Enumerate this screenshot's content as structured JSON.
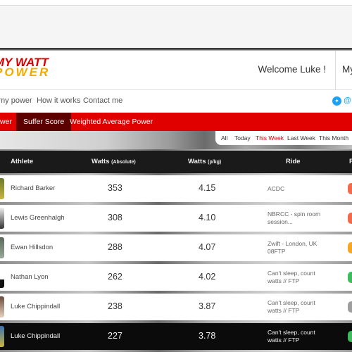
{
  "header": {
    "logo_line1": "MY WATT",
    "logo_line2": "POWER",
    "welcome": "Welcome Luke !",
    "my_menu": "My"
  },
  "nav": {
    "items": [
      {
        "label": "my power"
      },
      {
        "label": "How it works"
      },
      {
        "label": "Contact me"
      }
    ],
    "twitter_icon": "twitter-icon",
    "twitter_handle": "@"
  },
  "tabs": [
    {
      "label": "wer",
      "active": false
    },
    {
      "label": "Suffer Score",
      "active": true
    },
    {
      "label": "Weighted Average Power",
      "active": false
    }
  ],
  "filters": [
    {
      "label": "All",
      "active": false
    },
    {
      "label": "Today",
      "active": false
    },
    {
      "label": "This Week",
      "active": true
    },
    {
      "label": "Last Week",
      "active": false
    },
    {
      "label": "This Month",
      "active": false
    }
  ],
  "table": {
    "columns": {
      "athlete": "Athlete",
      "watts_abs": "Watts",
      "watts_abs_unit": "(Absolute)",
      "watts_pkg": "Watts",
      "watts_pkg_unit": "(p/kg)",
      "ride": "Ride",
      "last": "F"
    },
    "rows": [
      {
        "name": "Richard Barker",
        "watts_abs": "353",
        "watts_pkg": "4.15",
        "ride_line1": "ACDC",
        "ride_line2": "",
        "badge_color": "#f26a4b",
        "highlight": false
      },
      {
        "name": "Lewis Greenhalgh",
        "watts_abs": "308",
        "watts_pkg": "4.10",
        "ride_line1": "NBRCC - spin room",
        "ride_line2": "session...",
        "badge_color": "#f26a4b",
        "highlight": false
      },
      {
        "name": "Ewan Hillsdon",
        "watts_abs": "288",
        "watts_pkg": "4.07",
        "ride_line1": "Zwift - London, UK",
        "ride_line2": "08FTP",
        "badge_color": "#f5a623",
        "highlight": false
      },
      {
        "name": "Nathan Lyon",
        "watts_abs": "262",
        "watts_pkg": "4.02",
        "ride_line1": "Can't sleep, count",
        "ride_line2": "watts // FTP",
        "badge_color": "#3dbb5e",
        "highlight": false
      },
      {
        "name": "Luke Chippindall",
        "watts_abs": "238",
        "watts_pkg": "3.87",
        "ride_line1": "Can't sleep, count",
        "ride_line2": "watts // FTP",
        "badge_color": "#9e9e9e",
        "highlight": false
      },
      {
        "name": "Luke Chippindall",
        "watts_abs": "227",
        "watts_pkg": "3.78",
        "ride_line1": "Can't sleep, count",
        "ride_line2": "watts // FTP",
        "badge_color": "#3dbb5e",
        "highlight": true
      }
    ]
  },
  "colors": {
    "brand_red": "#e00000",
    "brand_yellow": "#f2a900",
    "active_tab": "#5c0000"
  }
}
